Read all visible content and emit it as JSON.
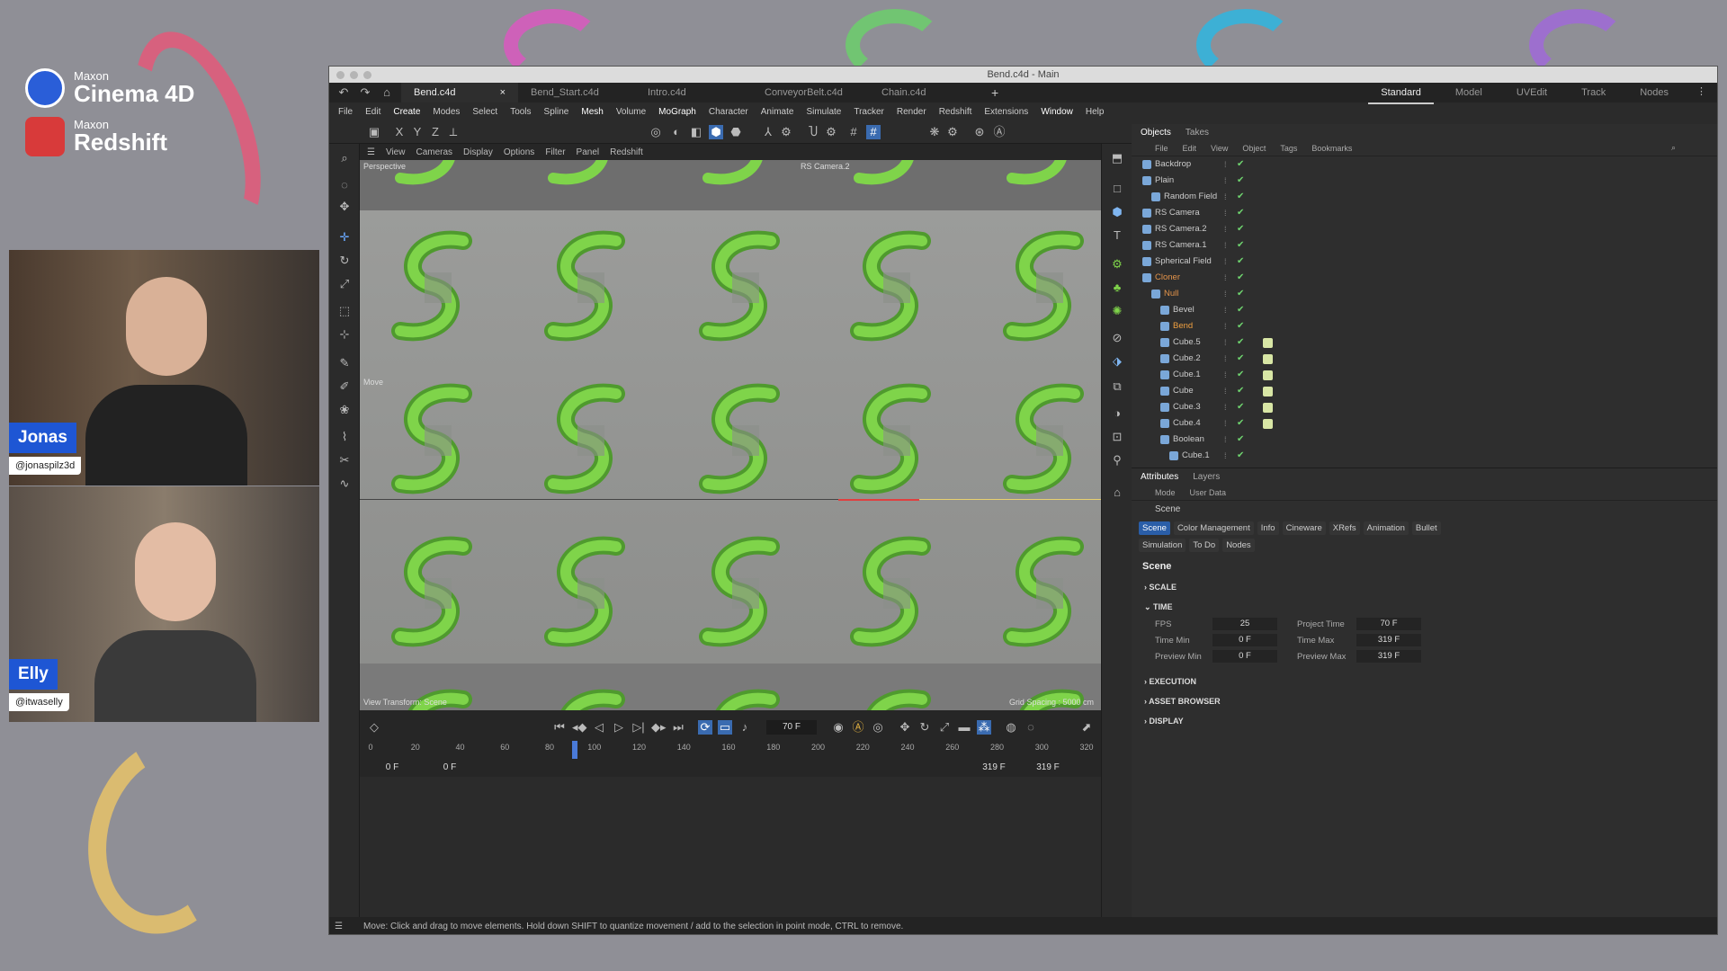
{
  "brand": {
    "maxon1": "Maxon",
    "product1": "Cinema 4D",
    "maxon2": "Maxon",
    "product2": "Redshift"
  },
  "presenters": [
    {
      "name": "Jonas",
      "handle": "@jonaspilz3d"
    },
    {
      "name": "Elly",
      "handle": "@itwaselly"
    }
  ],
  "window": {
    "title": "Bend.c4d - Main"
  },
  "doc_tabs": [
    "Bend.c4d",
    "Bend_Start.c4d",
    "Intro.c4d",
    "ConveyorBelt.c4d",
    "Chain.c4d"
  ],
  "layouts": [
    "Standard",
    "Model",
    "UVEdit",
    "Track",
    "Nodes"
  ],
  "menu": [
    "File",
    "Edit",
    "Create",
    "Modes",
    "Select",
    "Tools",
    "Spline",
    "Mesh",
    "Volume",
    "MoGraph",
    "Character",
    "Animate",
    "Simulate",
    "Tracker",
    "Render",
    "Redshift",
    "Extensions",
    "Window",
    "Help"
  ],
  "axis_labels": [
    "X",
    "Y",
    "Z"
  ],
  "viewport_menu": [
    "View",
    "Cameras",
    "Display",
    "Options",
    "Filter",
    "Panel",
    "Redshift"
  ],
  "viewport": {
    "camera_label": "Perspective",
    "rs_camera": "RS Camera.2",
    "view_transform": "View Transform: Scene",
    "grid_spacing": "Grid Spacing : 5000 cm",
    "move_label": "Move"
  },
  "timeline": {
    "current_frame": "70 F",
    "ticks": [
      "0",
      "20",
      "40",
      "60",
      "80",
      "100",
      "120",
      "140",
      "160",
      "180",
      "200",
      "220",
      "240",
      "260",
      "280",
      "300",
      "320"
    ],
    "start1": "0 F",
    "start2": "0 F",
    "end1": "319 F",
    "end2": "319 F"
  },
  "status": "Move: Click and drag to move elements. Hold down SHIFT to quantize movement / add to the selection in point mode, CTRL to remove.",
  "objects_panel": {
    "tabs": [
      "Objects",
      "Takes"
    ],
    "menu": [
      "File",
      "Edit",
      "View",
      "Object",
      "Tags",
      "Bookmarks"
    ],
    "items": [
      {
        "name": "Backdrop",
        "indent": 0
      },
      {
        "name": "Plain",
        "indent": 0
      },
      {
        "name": "Random Field",
        "indent": 1
      },
      {
        "name": "RS Camera",
        "indent": 0
      },
      {
        "name": "RS Camera.2",
        "indent": 0
      },
      {
        "name": "RS Camera.1",
        "indent": 0
      },
      {
        "name": "Spherical Field",
        "indent": 0
      },
      {
        "name": "Cloner",
        "indent": 0,
        "color": "#e3934a"
      },
      {
        "name": "Null",
        "indent": 1,
        "color": "#e3934a"
      },
      {
        "name": "Bevel",
        "indent": 2
      },
      {
        "name": "Bend",
        "indent": 2,
        "color": "#f0a040"
      },
      {
        "name": "Cube.5",
        "indent": 2
      },
      {
        "name": "Cube.2",
        "indent": 2
      },
      {
        "name": "Cube.1",
        "indent": 2
      },
      {
        "name": "Cube",
        "indent": 2
      },
      {
        "name": "Cube.3",
        "indent": 2
      },
      {
        "name": "Cube.4",
        "indent": 2
      },
      {
        "name": "Boolean",
        "indent": 2
      },
      {
        "name": "Cube.1",
        "indent": 3
      }
    ]
  },
  "attributes": {
    "tabs": [
      "Attributes",
      "Layers"
    ],
    "menu": [
      "Mode",
      "User Data"
    ],
    "object": "Scene",
    "chips": [
      "Scene",
      "Color Management",
      "Info",
      "Cineware",
      "XRefs",
      "Animation",
      "Bullet",
      "Simulation",
      "To Do",
      "Nodes"
    ],
    "section_title": "Scene",
    "sections": [
      "SCALE",
      "TIME",
      "EXECUTION",
      "ASSET BROWSER",
      "DISPLAY"
    ],
    "time_fields": [
      {
        "label": "FPS",
        "value": "25"
      },
      {
        "label": "Project Time",
        "value": "70 F"
      },
      {
        "label": "Time Min",
        "value": "0 F"
      },
      {
        "label": "Time Max",
        "value": "319 F"
      },
      {
        "label": "Preview Min",
        "value": "0 F"
      },
      {
        "label": "Preview Max",
        "value": "319 F"
      }
    ]
  },
  "colors": {
    "accent": "#2a5ea8",
    "shape_green": "#7fd44a",
    "name_tag": "#1e56d4"
  }
}
